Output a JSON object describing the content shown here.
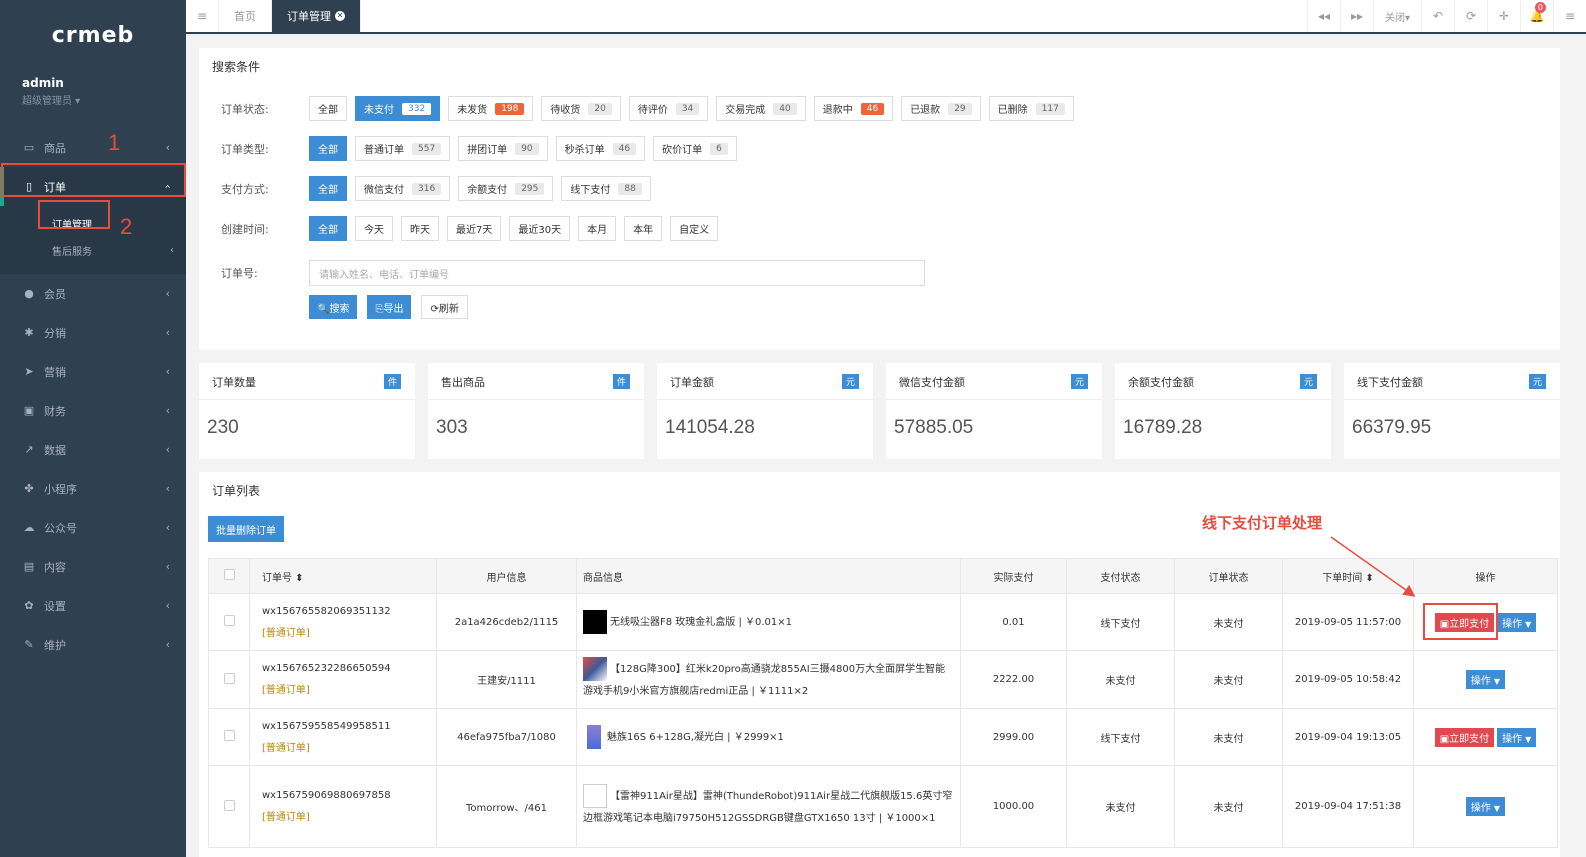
{
  "sidebar": {
    "logo": "crmeb",
    "user_name": "admin",
    "user_role": "超级管理员 ▾",
    "items": [
      {
        "icon": "▭",
        "label": "商品"
      },
      {
        "icon": "▯",
        "label": "订单"
      },
      {
        "icon": "●",
        "label": "会员"
      },
      {
        "icon": "✱",
        "label": "分销"
      },
      {
        "icon": "➤",
        "label": "营销"
      },
      {
        "icon": "▣",
        "label": "财务"
      },
      {
        "icon": "↗",
        "label": "数据"
      },
      {
        "icon": "✤",
        "label": "小程序"
      },
      {
        "icon": "☁",
        "label": "公众号"
      },
      {
        "icon": "▤",
        "label": "内容"
      },
      {
        "icon": "✿",
        "label": "设置"
      },
      {
        "icon": "✎",
        "label": "维护"
      }
    ],
    "sub_items": [
      "订单管理",
      "售后服务"
    ],
    "annotation_1": "1",
    "annotation_2": "2"
  },
  "topbar": {
    "menu_icon": "≡",
    "tabs": [
      "首页",
      "订单管理"
    ],
    "close_label": "关闭▾",
    "bell_count": "0"
  },
  "search": {
    "title": "搜索条件",
    "status_label": "订单状态:",
    "status_options": [
      {
        "label": "全部",
        "count": ""
      },
      {
        "label": "未支付",
        "count": "332"
      },
      {
        "label": "未发货",
        "count": "198"
      },
      {
        "label": "待收货",
        "count": "20"
      },
      {
        "label": "待评价",
        "count": "34"
      },
      {
        "label": "交易完成",
        "count": "40"
      },
      {
        "label": "退款中",
        "count": "46"
      },
      {
        "label": "已退款",
        "count": "29"
      },
      {
        "label": "已删除",
        "count": "117"
      }
    ],
    "type_label": "订单类型:",
    "type_options": [
      {
        "label": "全部",
        "count": ""
      },
      {
        "label": "普通订单",
        "count": "557"
      },
      {
        "label": "拼团订单",
        "count": "90"
      },
      {
        "label": "秒杀订单",
        "count": "46"
      },
      {
        "label": "砍价订单",
        "count": "6"
      }
    ],
    "pay_label": "支付方式:",
    "pay_options": [
      {
        "label": "全部",
        "count": ""
      },
      {
        "label": "微信支付",
        "count": "316"
      },
      {
        "label": "余额支付",
        "count": "295"
      },
      {
        "label": "线下支付",
        "count": "88"
      }
    ],
    "time_label": "创建时间:",
    "time_options": [
      "全部",
      "今天",
      "昨天",
      "最近7天",
      "最近30天",
      "本月",
      "本年",
      "自定义"
    ],
    "order_no_label": "订单号:",
    "order_no_placeholder": "请输入姓名、电话、订单编号",
    "search_btn": "🔍搜索",
    "export_btn": "⎘导出",
    "refresh_btn": "⟳刷新"
  },
  "stats": [
    {
      "title": "订单数量",
      "unit": "件",
      "value": "230"
    },
    {
      "title": "售出商品",
      "unit": "件",
      "value": "303"
    },
    {
      "title": "订单金额",
      "unit": "元",
      "value": "141054.28"
    },
    {
      "title": "微信支付金额",
      "unit": "元",
      "value": "57885.05"
    },
    {
      "title": "余额支付金额",
      "unit": "元",
      "value": "16789.28"
    },
    {
      "title": "线下支付金额",
      "unit": "元",
      "value": "66379.95"
    }
  ],
  "orders": {
    "title": "订单列表",
    "batch_delete": "批量删除订单",
    "annotation": "线下支付订单处理",
    "columns": [
      "订单号 ⬍",
      "用户信息",
      "商品信息",
      "实际支付",
      "支付状态",
      "订单状态",
      "下单时间 ⬍",
      "操作"
    ],
    "pay_now_label": "立即支付",
    "op_label": "操作",
    "rows": [
      {
        "order_no": "wx156765582069351132",
        "tag": "[普通订单]",
        "user": "2a1a426cdeb2/1115",
        "goods": "无线吸尘器F8 玫瑰金礼盒版 | ￥0.01×1",
        "paid": "0.01",
        "pay_status": "线下支付",
        "order_status": "未支付",
        "time": "2019-09-05 11:57:00",
        "pay_now": true
      },
      {
        "order_no": "wx156765232286650594",
        "tag": "[普通订单]",
        "user": "王建安/1111",
        "goods": "【128G降300】红米k20pro高通骁龙855AI三摄4800万大全面屏学生智能游戏手机9小米官方旗舰店redmi正品 | ￥1111×2",
        "paid": "2222.00",
        "pay_status": "未支付",
        "order_status": "未支付",
        "time": "2019-09-05 10:58:42",
        "pay_now": false
      },
      {
        "order_no": "wx156759558549958511",
        "tag": "[普通订单]",
        "user": "46efa975fba7/1080",
        "goods": "魅族16S 6+128G,凝光白 | ￥2999×1",
        "paid": "2999.00",
        "pay_status": "线下支付",
        "order_status": "未支付",
        "time": "2019-09-04 19:13:05",
        "pay_now": true
      },
      {
        "order_no": "wx156759069880697858",
        "tag": "[普通订单]",
        "user": "Tomorrow、/461",
        "goods": "【雷神911Air星战】雷神(ThundeRobot)911Air星战二代旗舰版15.6英寸窄边框游戏笔记本电脑i79750H512GSSDRGB键盘GTX1650 13寸 | ￥1000×1",
        "paid": "1000.00",
        "pay_status": "未支付",
        "order_status": "未支付",
        "time": "2019-09-04 17:51:38",
        "pay_now": false
      }
    ]
  }
}
